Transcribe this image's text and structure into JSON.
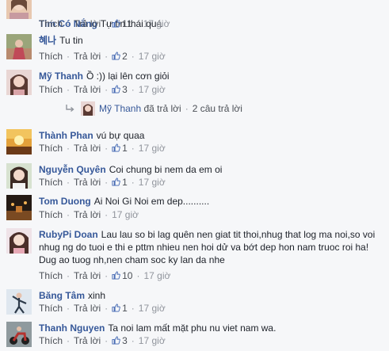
{
  "ui": {
    "like_label": "Thích",
    "reply_label": "Trả lời",
    "separator": "·"
  },
  "comments": [
    {
      "name": "Tim Có Nắng",
      "text": "Tự tin thái quá",
      "likes": "11",
      "time": "17 giờ",
      "avatar": "woman-portrait-avatar"
    },
    {
      "name": "혜나",
      "text": "Tu tin",
      "likes": "2",
      "time": "17 giờ",
      "avatar": "woman-outdoor-avatar"
    },
    {
      "name": "Mỹ Thanh",
      "text": "Ồ :)) lại lên cơn giỏi",
      "likes": "3",
      "time": "17 giờ",
      "avatar": "woman-portrait-avatar"
    },
    {
      "name": "Thành Phan",
      "text": "vú bự quaa",
      "likes": "1",
      "time": "17 giờ",
      "avatar": "sunset-avatar"
    },
    {
      "name": "Nguyễn Quyên",
      "text": "Coi chung bi nem da em oi",
      "likes": "1",
      "time": "17 giờ",
      "avatar": "woman-portrait-avatar"
    },
    {
      "name": "Tom Duong",
      "text": "Ai Noi Gi Noi em dep..........",
      "likes": "",
      "time": "17 giờ",
      "avatar": "night-scene-avatar"
    },
    {
      "name": "RubyPi Doan",
      "text": "Lau lau so bi lag quên nen giat tit thoi,nhug that log ma noi,so voi nhug ng do tuoi e thi e pttm nhieu nen hoi dử va bớt dep hon nam truoc roi ha! Dug ao tuog nh,nen cham soc ky lan da nhe",
      "likes": "10",
      "time": "17 giờ",
      "avatar": "woman-portrait-avatar"
    },
    {
      "name": "Băng Tâm",
      "text": "xinh",
      "likes": "1",
      "time": "17 giờ",
      "avatar": "dancer-avatar"
    },
    {
      "name": "Thanh Nguyen",
      "text": "Ta noi lam mất mặt phu nu viet nam wa.",
      "likes": "3",
      "time": "17 giờ",
      "avatar": "motorbike-avatar"
    }
  ],
  "reply_summary": {
    "name": "Mỹ Thanh",
    "action": "đã trả lời",
    "count_text": "2 câu trả lời"
  },
  "colors": {
    "name_link": "#365899",
    "meta": "#90949c",
    "like_blue": "#4267b2"
  }
}
